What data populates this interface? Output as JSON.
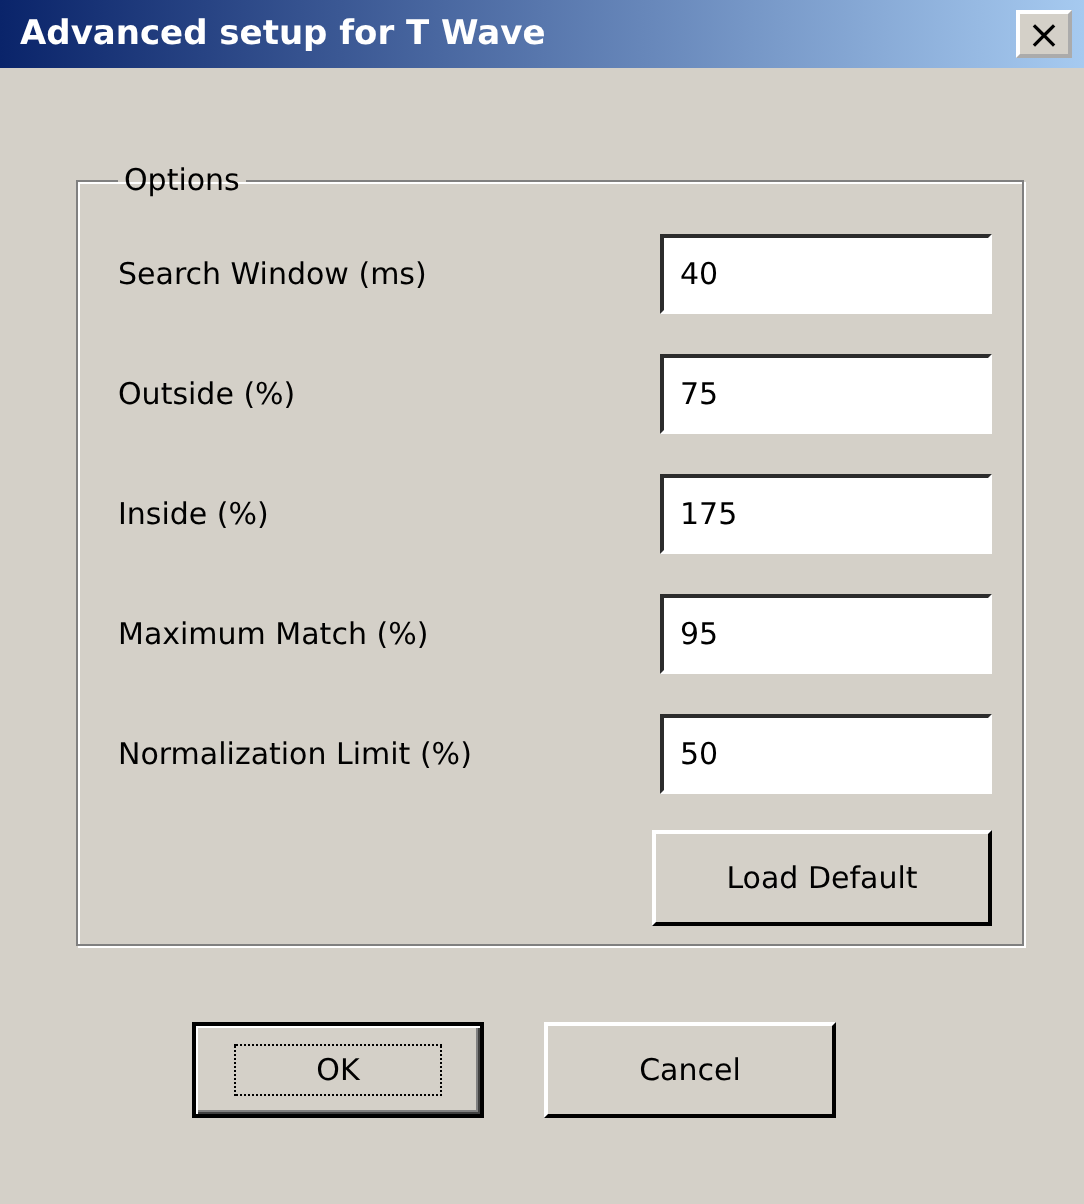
{
  "window": {
    "title": "Advanced setup for T Wave",
    "close": "×"
  },
  "group": {
    "legend": "Options",
    "fields": [
      {
        "label": "Search Window (ms)",
        "value": "40"
      },
      {
        "label": "Outside (%)",
        "value": "75"
      },
      {
        "label": "Inside (%)",
        "value": "175"
      },
      {
        "label": "Maximum Match (%)",
        "value": "95"
      },
      {
        "label": "Normalization Limit (%)",
        "value": "50"
      }
    ],
    "load_default": "Load Default"
  },
  "buttons": [
    {
      "label": "OK",
      "focused": true
    },
    {
      "label": "Cancel",
      "focused": false
    }
  ]
}
